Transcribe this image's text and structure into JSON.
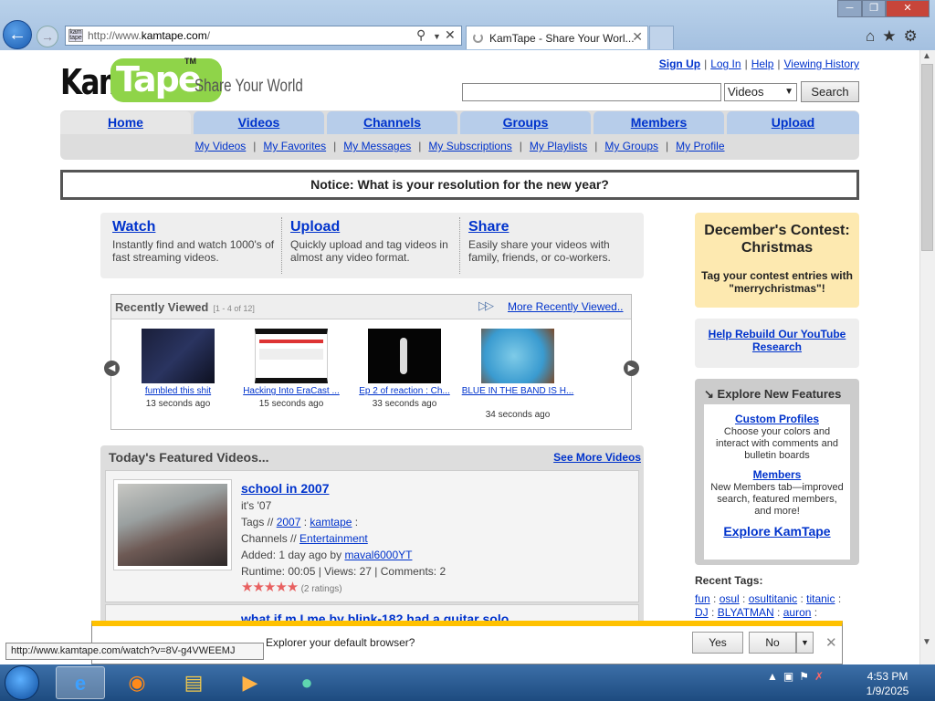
{
  "browser": {
    "address_prefix": "http://www.",
    "address_domain": "kamtape.com",
    "address_suffix": "/",
    "tab_title": "KamTape - Share Your Worl...",
    "back_icon": "back-arrow-icon",
    "forward_icon": "forward-arrow-icon"
  },
  "logo": {
    "kam": "Kam",
    "tape": "Tape",
    "tm": "TM",
    "slogan": "Share Your World"
  },
  "toplinks": [
    "Sign Up",
    "Log In",
    "Help",
    "Viewing History"
  ],
  "search": {
    "value": "",
    "select": "Videos",
    "button": "Search"
  },
  "nav": {
    "tabs": [
      "Home",
      "Videos",
      "Channels",
      "Groups",
      "Members",
      "Upload"
    ],
    "active": "Home",
    "sub": [
      "My Videos",
      "My Favorites",
      "My Messages",
      "My Subscriptions",
      "My Playlists",
      "My Groups",
      "My Profile"
    ]
  },
  "notice": "Notice: What is your resolution for the new year?",
  "intro": [
    {
      "title": "Watch",
      "desc": "Instantly find and watch 1000's of fast streaming videos."
    },
    {
      "title": "Upload",
      "desc": "Quickly upload and tag videos in almost any video format."
    },
    {
      "title": "Share",
      "desc": "Easily share your videos with family, friends, or co-workers."
    }
  ],
  "recent": {
    "title": "Recently Viewed",
    "count": "[1 - 4 of 12]",
    "more": "More Recently Viewed..",
    "items": [
      {
        "caption": "fumbled this shit",
        "time": "13 seconds ago"
      },
      {
        "caption": "Hacking Into EraCast ...",
        "time": "15 seconds ago"
      },
      {
        "caption": "Ep 2 of reaction : Ch...",
        "time": "33 seconds ago"
      },
      {
        "caption": "BLUE IN THE BAND IS H...",
        "time": "34 seconds ago"
      }
    ]
  },
  "featured": {
    "header": "Today's Featured Videos...",
    "more": "See More Videos",
    "item": {
      "title": "school in 2007",
      "desc": "it's '07",
      "tags_label": "Tags //",
      "tags": [
        "2007",
        "kamtape"
      ],
      "channels_label": "Channels //",
      "channel": "Entertainment",
      "added": "Added: 1 day ago by",
      "user": "maval6000YT",
      "stats": "Runtime: 00:05 | Views: 27 | Comments: 2",
      "ratings": "(2 ratings)",
      "stars": 5
    },
    "next_title": "what if m I me by blink-182 had a guitar solo"
  },
  "sidebar": {
    "contest_title": "December's Contest: Christmas",
    "contest_desc": "Tag your contest entries with \"merrychristmas\"!",
    "rebuild": "Help Rebuild Our YouTube Research",
    "explore_header": "Explore New Features",
    "feat1_title": "Custom Profiles",
    "feat1_desc": "Choose your colors and interact with comments and bulletin boards",
    "feat2_title": "Members",
    "feat2_desc": "New Members tab—improved search, featured members, and more!",
    "explore_link": "Explore KamTape",
    "tags_header": "Recent Tags:",
    "tags": [
      "fun",
      "osul",
      "osultitanic",
      "titanic",
      "DJ",
      "BLYATMAN",
      "auron"
    ]
  },
  "notification": {
    "message": "Explorer your default browser?",
    "yes": "Yes",
    "no": "No"
  },
  "status_url": "http://www.kamtape.com/watch?v=8V-g4VWEEMJ",
  "taskbar": {
    "time": "4:53 PM",
    "date": "1/9/2025",
    "apps": [
      "internet-explorer-icon",
      "firefox-icon",
      "file-explorer-icon",
      "media-player-icon",
      "chat-app-icon"
    ]
  },
  "colors": {
    "nav_tab": "#b7cdea",
    "link": "#0033cc",
    "logo_green": "#8fd449",
    "contest_bg": "#fde9b0",
    "notif_bar": "#ffc100"
  }
}
